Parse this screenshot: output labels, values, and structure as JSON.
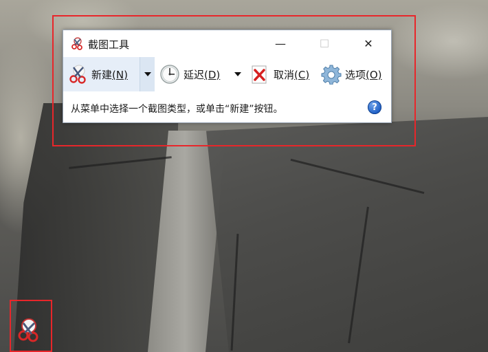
{
  "window": {
    "title": "截图工具",
    "caption_buttons": {
      "minimize": "—",
      "maximize": "☐",
      "close": "✕"
    }
  },
  "toolbar": {
    "new": {
      "label": "新建",
      "accel": "(N)",
      "icon": "scissors-icon"
    },
    "delay": {
      "label": "延迟",
      "accel": "(D)",
      "icon": "clock-icon"
    },
    "cancel": {
      "label": "取消",
      "accel": "(C)",
      "icon": "red-x-icon"
    },
    "options": {
      "label": "选项",
      "accel": "(O)",
      "icon": "gear-icon"
    }
  },
  "status": {
    "text": "从菜单中选择一个截图类型，或单击“新建”按钮。",
    "help_glyph": "?"
  },
  "colors": {
    "highlight": "#e8262a",
    "new_button_bg": "#e6eef8",
    "help_blue": "#1f5fc5"
  }
}
